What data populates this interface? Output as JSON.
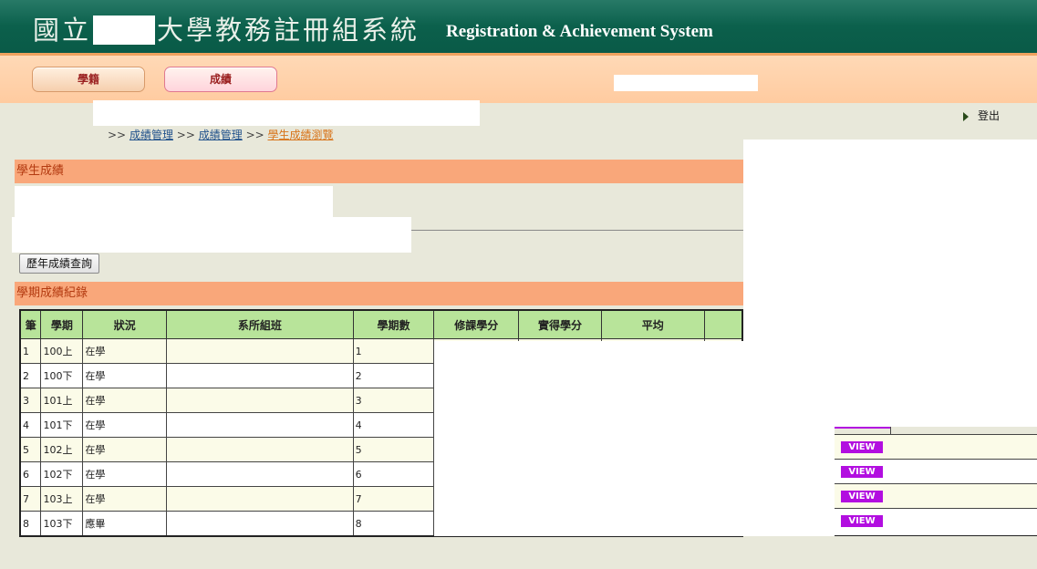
{
  "header": {
    "title_prefix": "國立",
    "title_suffix": "大學教務註冊組系統",
    "title_en": "Registration & Achievement System"
  },
  "nav": {
    "tabs": [
      {
        "label": "學籍"
      },
      {
        "label": "成績"
      }
    ]
  },
  "logout_label": "登出",
  "breadcrumb": {
    "sep": ">>",
    "items": [
      "成績管理",
      "成績管理",
      "學生成績瀏覽"
    ]
  },
  "sections": {
    "student_grades": "學生成績",
    "semester_records": "學期成績紀錄"
  },
  "history_button": "歷年成績查詢",
  "table": {
    "headers": [
      "筆",
      "學期",
      "狀況",
      "系所組班",
      "學期數",
      "修課學分",
      "實得學分",
      "平均",
      ""
    ],
    "rows": [
      {
        "no": "1",
        "term": "100上",
        "status": "在學",
        "count": "1"
      },
      {
        "no": "2",
        "term": "100下",
        "status": "在學",
        "count": "2"
      },
      {
        "no": "3",
        "term": "101上",
        "status": "在學",
        "count": "3"
      },
      {
        "no": "4",
        "term": "101下",
        "status": "在學",
        "count": "4"
      },
      {
        "no": "5",
        "term": "102上",
        "status": "在學",
        "count": "5"
      },
      {
        "no": "6",
        "term": "102下",
        "status": "在學",
        "count": "6"
      },
      {
        "no": "7",
        "term": "103上",
        "status": "在學",
        "count": "7"
      },
      {
        "no": "8",
        "term": "103下",
        "status": "應畢",
        "count": "8"
      }
    ],
    "view_label": "VIEW"
  },
  "colors": {
    "header_green": "#0b5f4b",
    "section_orange": "#f9a77a",
    "table_header_green": "#b8e49a",
    "view_purple": "#b20ee0"
  }
}
